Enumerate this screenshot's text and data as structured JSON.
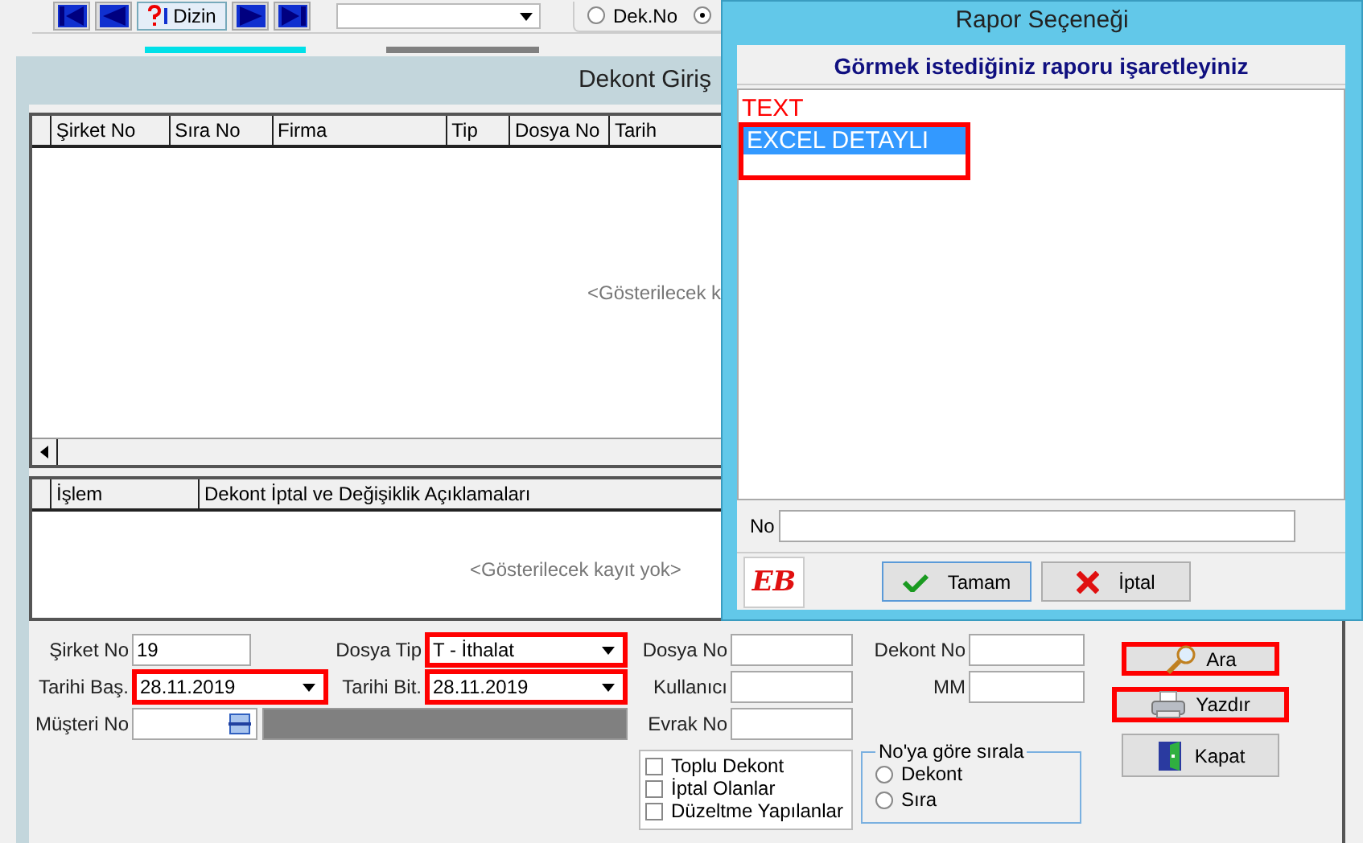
{
  "toolbar": {
    "nav_buttons": [
      {
        "kind": "first"
      },
      {
        "kind": "prev"
      },
      {
        "kind": "index",
        "label": "Dizin"
      },
      {
        "kind": "next"
      },
      {
        "kind": "last"
      }
    ],
    "radios": [
      {
        "label": "Dek.No",
        "selected": false
      },
      {
        "selected": true
      }
    ]
  },
  "main_window": {
    "title": "Dekont Giriş",
    "records_grid": {
      "columns": [
        "Şirket No",
        "Sıra No",
        "Firma",
        "Tip",
        "Dosya No",
        "Tarih"
      ],
      "empty_text": "<Gösterilecek k"
    },
    "notes_grid": {
      "columns": [
        "İşlem",
        "Dekont İptal ve Değişiklik Açıklamaları"
      ],
      "empty_text": "<Gösterilecek kayıt yok>"
    },
    "filter_rows": [
      [
        {
          "label": "Şirket No",
          "value": "19",
          "kind": "text",
          "highlighted": false
        },
        {
          "label": "Dosya Tip",
          "value": "T - İthalat",
          "kind": "combo",
          "highlighted": true
        },
        {
          "label": "Dosya No",
          "kind": "text",
          "highlighted": false
        },
        {
          "label": "Dekont No",
          "kind": "text",
          "highlighted": false
        }
      ],
      [
        {
          "label": "Tarihi Baş.",
          "value": "28.11.2019",
          "kind": "combo",
          "highlighted": true
        },
        {
          "label": "Tarihi Bit.",
          "value": "28.11.2019",
          "kind": "combo",
          "highlighted": true
        },
        {
          "label": "Kullanıcı",
          "kind": "text",
          "highlighted": false
        },
        {
          "label": "MM",
          "kind": "text",
          "highlighted": false
        }
      ],
      [
        {
          "label": "Müşteri No",
          "kind": "lookup",
          "highlighted": false
        },
        {
          "label": "Evrak No",
          "kind": "text",
          "highlighted": false
        }
      ]
    ],
    "checkboxes": [
      {
        "label": "Toplu Dekont",
        "checked": false
      },
      {
        "label": "İptal Olanlar",
        "checked": false
      },
      {
        "label": "Düzeltme Yapılanlar",
        "checked": false
      }
    ],
    "sort_group": {
      "title": "No'ya göre sırala",
      "options": [
        {
          "label": "Dekont",
          "selected": false
        },
        {
          "label": "Sıra",
          "selected": false
        }
      ]
    },
    "buttons": [
      {
        "label": "Ara",
        "kind": "search",
        "highlighted": true
      },
      {
        "label": "Yazdır",
        "kind": "print",
        "highlighted": true
      },
      {
        "label": "Kapat",
        "kind": "exit",
        "highlighted": false
      }
    ]
  },
  "dialog": {
    "title": "Rapor Seçeneği",
    "heading": "Görmek istediğiniz raporu işaretleyiniz",
    "options": [
      {
        "label": "TEXT",
        "color": "#ff0000",
        "selected": false,
        "highlighted": false
      },
      {
        "label": "EXCEL DETAYLI",
        "selected": true,
        "highlighted": true
      }
    ],
    "no_field": {
      "label": "No"
    },
    "logo": "EB",
    "buttons": [
      {
        "label": "Tamam",
        "kind": "ok"
      },
      {
        "label": "İptal",
        "kind": "cancel"
      }
    ]
  }
}
